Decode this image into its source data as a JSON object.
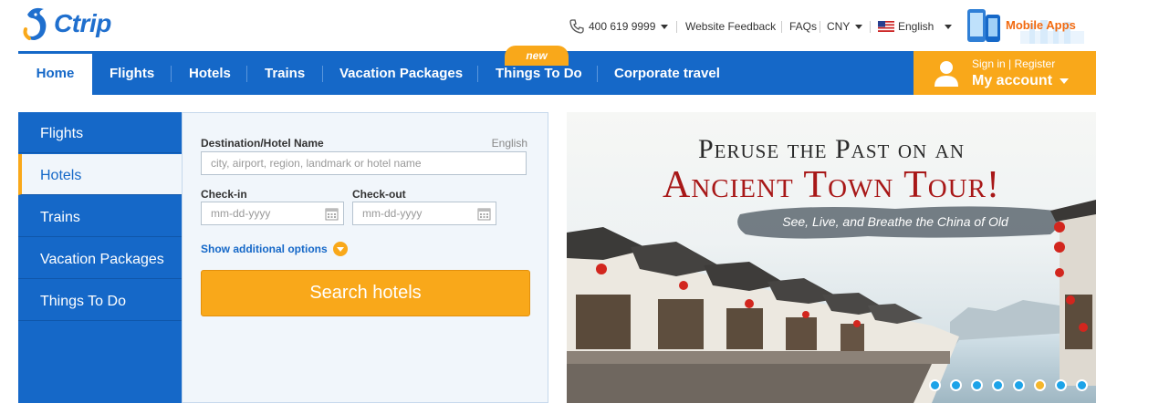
{
  "header": {
    "brand": "Ctrip",
    "phone": "400 619 9999",
    "feedback": "Website Feedback",
    "faqs": "FAQs",
    "currency": "CNY",
    "language": "English",
    "mobile_apps": "Mobile Apps"
  },
  "nav": {
    "items": [
      "Home",
      "Flights",
      "Hotels",
      "Trains",
      "Vacation Packages",
      "Things To Do",
      "Corporate travel"
    ],
    "active": "Home",
    "new_badge": "new"
  },
  "account": {
    "sign_in": "Sign in",
    "separator": "|",
    "register": "Register",
    "title": "My account"
  },
  "search": {
    "tabs": [
      "Flights",
      "Hotels",
      "Trains",
      "Vacation Packages",
      "Things To Do"
    ],
    "active_tab": "Hotels",
    "destination_label": "Destination/Hotel Name",
    "language_hint": "English",
    "destination_placeholder": "city, airport, region, landmark or hotel name",
    "checkin_label": "Check-in",
    "checkout_label": "Check-out",
    "checkin_placeholder": "mm-dd-yyyy",
    "checkout_placeholder": "mm-dd-yyyy",
    "more_options": "Show additional options",
    "submit": "Search hotels"
  },
  "banner": {
    "title_line1": "Peruse the Past on an",
    "title_line2": "Ancient Town Tour!",
    "subtitle": "See, Live, and Breathe the China of Old",
    "slide_count": 8,
    "active_slide": 6
  },
  "colors": {
    "brand_blue": "#1568c8",
    "accent_orange": "#f9a81a",
    "banner_red": "#a81818"
  }
}
